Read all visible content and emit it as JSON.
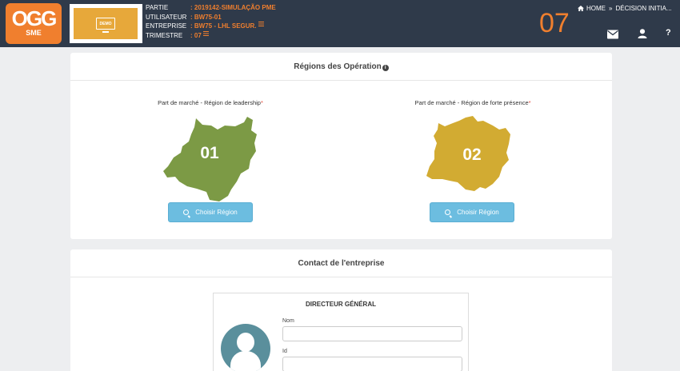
{
  "header": {
    "logo_main": "OGG",
    "logo_sub": "SME",
    "demo_label": "DEMO",
    "info": [
      {
        "label": "PARTIE",
        "value": ": 2019142-SIMULAÇÃO PME",
        "list_icon": false
      },
      {
        "label": "UTILISATEUR",
        "value": ": BW75-01",
        "list_icon": false
      },
      {
        "label": "ENTREPRISE",
        "value": ": BW75 - LHL SEGUR.",
        "list_icon": true
      },
      {
        "label": "TRIMESTRE",
        "value": ": 07",
        "list_icon": true
      }
    ],
    "turn_number": "07",
    "breadcrumb": {
      "home": "HOME",
      "separator": "»",
      "current": "DÉCISION INITIA..."
    },
    "icons": [
      "envelope-icon",
      "user-icon",
      "help-icon"
    ],
    "help_glyph": "?"
  },
  "regions_panel": {
    "title": "Régions des Opération",
    "info_glyph": "i",
    "regions": [
      {
        "caption": "Part de marché - Région de leadership",
        "required": "*",
        "number": "01",
        "color": "#7c9a45",
        "button": "Choisir Région"
      },
      {
        "caption": "Part de marché - Région de forte présence",
        "required": "*",
        "number": "02",
        "color": "#d2ab32",
        "button": "Choisir Région"
      }
    ]
  },
  "contact_panel": {
    "title": "Contact de l'entreprise",
    "card_title": "DIRECTEUR GÉNÉRAL",
    "fields": [
      {
        "label": "Nom",
        "value": ""
      },
      {
        "label": "Id",
        "value": ""
      }
    ]
  },
  "colors": {
    "topbar": "#2f3a4a",
    "accent": "#f07f2e",
    "button": "#6cbde0",
    "avatar": "#5a8f9c"
  }
}
